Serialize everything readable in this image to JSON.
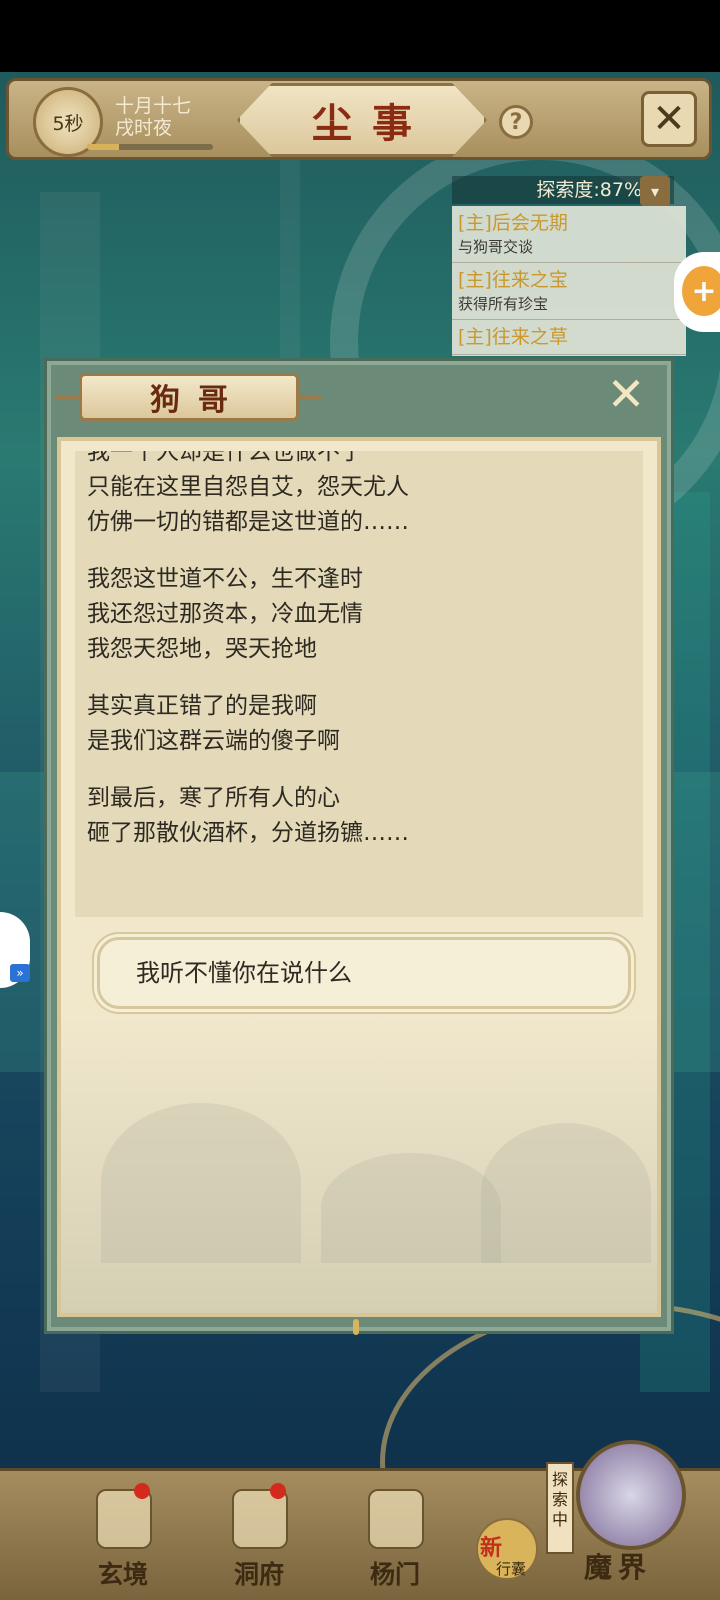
{
  "top_bar": {
    "timer": "5秒",
    "date_line1": "十月十七",
    "date_line2": "戌时夜",
    "date_progress": 0.25,
    "title": "尘事",
    "help": "?",
    "close_icon": "close-x-icon"
  },
  "exploration": {
    "label": "探索度:87%",
    "quests": [
      {
        "title": "[主]后会无期",
        "subtitle": "与狗哥交谈"
      },
      {
        "title": "[主]往来之宝",
        "subtitle": "获得所有珍宝"
      },
      {
        "title": "[主]往来之草",
        "subtitle": ""
      }
    ]
  },
  "dialog": {
    "npc_name": "狗哥",
    "paragraphs": [
      [
        "我一个人却是什么也做不了",
        "只能在这里自怨自艾，怨天尤人",
        "仿佛一切的错都是这世道的……"
      ],
      [
        "我怨这世道不公，生不逢时",
        "我还怨过那资本，冷血无情",
        "我怨天怨地，哭天抢地"
      ],
      [
        "其实真正错了的是我啊",
        "是我们这群云端的傻子啊"
      ],
      [
        "到最后，寒了所有人的心",
        "砸了那散伙酒杯，分道扬镳……"
      ]
    ],
    "choice": "我听不懂你在说什么"
  },
  "bottom_nav": {
    "items": [
      {
        "label": "玄境",
        "badge": true
      },
      {
        "label": "洞府",
        "badge": true
      },
      {
        "label": "杨门",
        "badge": false
      }
    ],
    "new_badge": "新",
    "new_badge_sub": "行囊",
    "exploring": "探索中",
    "realm": "魔界"
  },
  "colors": {
    "accent_gold": "#c9992e",
    "title_red": "#8a2c12",
    "badge_red": "#d42a1e"
  }
}
